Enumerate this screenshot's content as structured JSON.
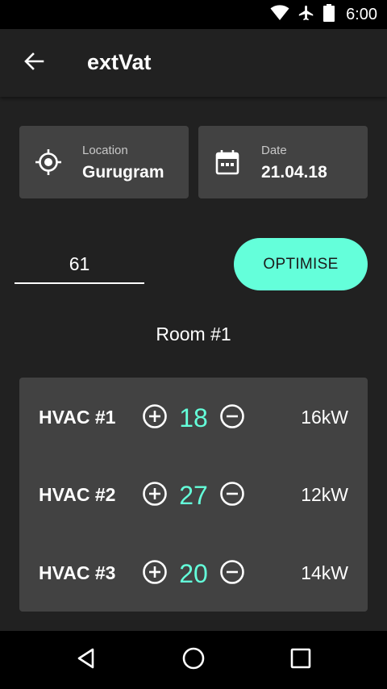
{
  "status_bar": {
    "time": "6:00",
    "icons": [
      "wifi-icon",
      "airplane-icon",
      "battery-icon"
    ]
  },
  "app_bar": {
    "title": "extVat",
    "back_icon": "arrow-back-icon"
  },
  "location_card": {
    "label": "Location",
    "value": "Gurugram",
    "icon": "location-target-icon"
  },
  "date_card": {
    "label": "Date",
    "value": "21.04.18",
    "icon": "calendar-icon"
  },
  "input": {
    "value": "61"
  },
  "optimise_button": {
    "label": "OPTIMISE"
  },
  "room": {
    "title": "Room #1"
  },
  "hvac_units": [
    {
      "name": "HVAC #1",
      "temperature": "18",
      "power": "16kW"
    },
    {
      "name": "HVAC #2",
      "temperature": "27",
      "power": "12kW"
    },
    {
      "name": "HVAC #3",
      "temperature": "20",
      "power": "14kW"
    }
  ],
  "nav_bar": {
    "icons": [
      "back-triangle-icon",
      "home-circle-icon",
      "recents-square-icon"
    ]
  },
  "colors": {
    "background": "#212121",
    "card": "#424242",
    "accent": "#64ffda",
    "system_bar": "#000000"
  }
}
